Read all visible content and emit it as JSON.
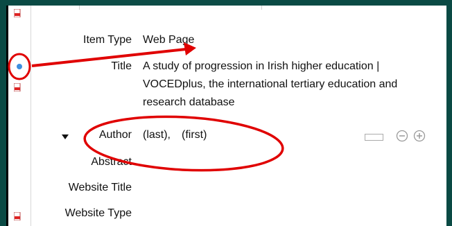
{
  "fields": {
    "item_type": {
      "label": "Item Type",
      "value": "Web Page"
    },
    "title": {
      "label": "Title",
      "value": "A study of progression in Irish higher education | VOCEDplus, the international tertiary education and research database"
    },
    "author": {
      "label": "Author",
      "last": "(last),",
      "first": "(first)"
    },
    "abstract": {
      "label": "Abstract"
    },
    "website_title": {
      "label": "Website Title"
    },
    "website_type": {
      "label": "Website Type"
    }
  },
  "icons": {
    "attachment": "pdf-icon",
    "selected_item": "blue-dot-icon",
    "author_toggle": "triangle-down-icon",
    "creator_switch": "single-field-toggle-icon",
    "remove": "minus-circle-icon",
    "add": "plus-circle-icon"
  },
  "colors": {
    "background": "#0a4a44",
    "annotation": "#e00000",
    "selected_dot": "#3d8fe0"
  }
}
